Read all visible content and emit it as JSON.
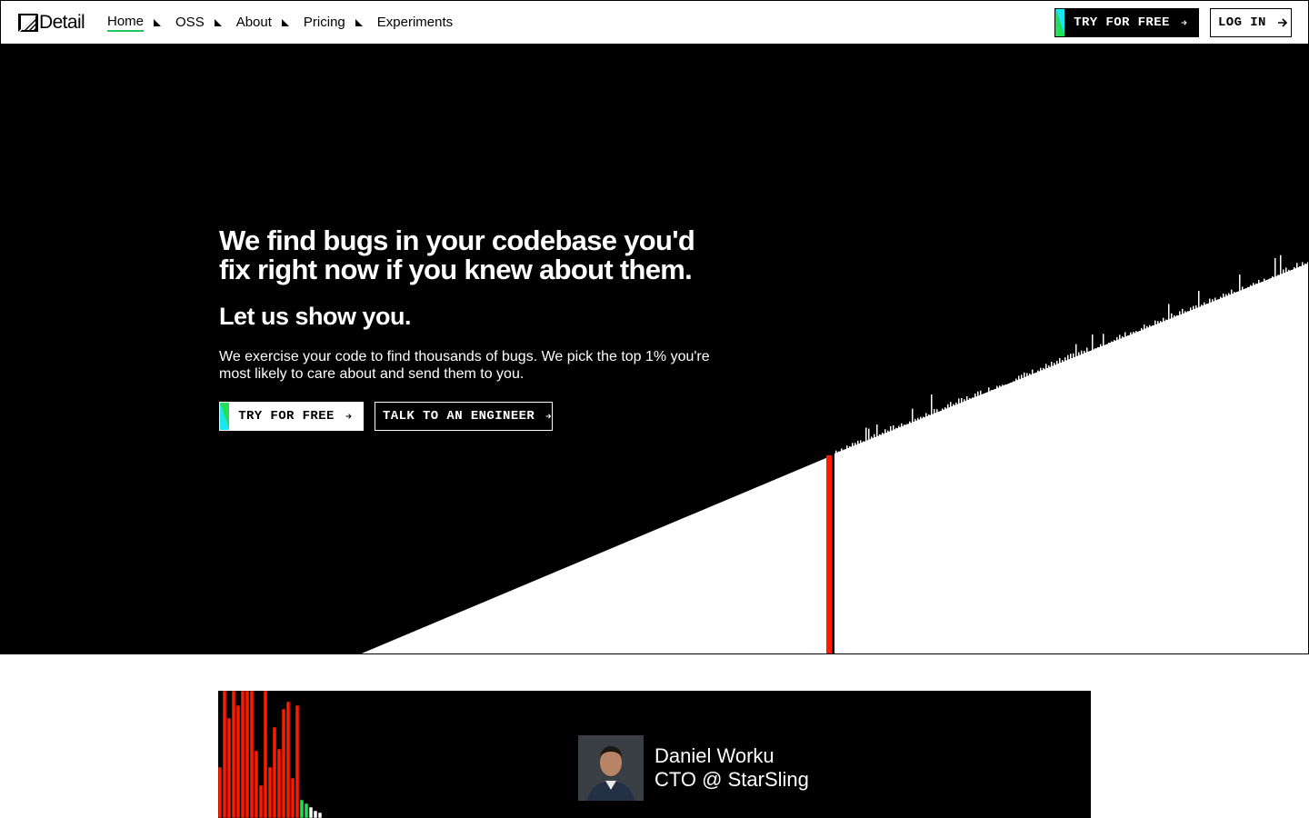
{
  "brand": {
    "name": "Detail",
    "logo_icon": "detail-logo-icon"
  },
  "nav": {
    "links": [
      {
        "label": "Home",
        "active": true
      },
      {
        "label": "OSS",
        "active": false
      },
      {
        "label": "About",
        "active": false
      },
      {
        "label": "Pricing",
        "active": false
      },
      {
        "label": "Experiments",
        "active": false
      }
    ],
    "try_label": "TRY FOR FREE",
    "login_label": "LOG IN"
  },
  "hero": {
    "title": "We find bugs in your codebase you'd fix right now if you knew about them.",
    "subtitle": "Let us show you.",
    "description": "We exercise your code to find thousands of bugs. We pick the top 1% you're most likely to care about and send them to you.",
    "try_label": "TRY FOR FREE",
    "talk_label": "TALK TO AN ENGINEER"
  },
  "testimonial": {
    "name": "Daniel Worku",
    "role": "CTO @ StarSling"
  },
  "colors": {
    "accent_green": "#22c55e",
    "gradient_cyan": "#18e6f0",
    "gradient_green": "#22e055",
    "highlight_red": "#ff1a00",
    "background_dark": "#000000",
    "background_light": "#ffffff"
  }
}
